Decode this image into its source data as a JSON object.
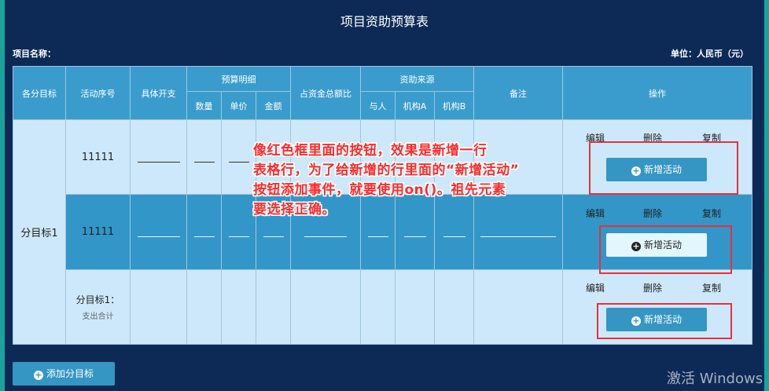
{
  "page": {
    "title": "项目资助预算表",
    "project_name_label": "项目名称：",
    "unit_label": "单位：人民币（元）"
  },
  "table": {
    "headers": {
      "sub_goal": "各分目标",
      "activity_no": "活动序号",
      "expense": "具体开支",
      "budget_detail": "预算明细",
      "qty": "数量",
      "unit_price": "单价",
      "amount": "金额",
      "ratio": "占资金总额比",
      "funding_source": "资助来源",
      "self": "与人",
      "org_a": "机构A",
      "org_b": "机构B",
      "remark": "备注",
      "ops": "操作"
    },
    "goal_cell": "分目标1",
    "rows": [
      {
        "activity_no": "11111"
      },
      {
        "activity_no": "11111"
      }
    ],
    "summary": {
      "line1": "分目标1：",
      "line2": "支出合计"
    },
    "ops": {
      "edit": "编辑",
      "delete": "删除",
      "copy": "复制",
      "add_activity": "新增活动"
    }
  },
  "annotation": {
    "line1": "像红色框里面的按钮，效果是新增一行",
    "line2": "表格行，为了给新增的行里面的“新增活动”",
    "line3": "按钮添加事件，就要使用on()。祖先元素",
    "line4": "要选择正确。"
  },
  "add_goal_label": "添加分目标",
  "watermark": "激活 Windows",
  "colors": {
    "background": "#0d2a57",
    "header": "#3a9ccd",
    "row_light": "#cde8fa",
    "row_dark": "#3396c8",
    "button": "#3596c4",
    "highlight_box": "#e8313a"
  },
  "icons": {
    "plus": "plus-circle-icon"
  }
}
